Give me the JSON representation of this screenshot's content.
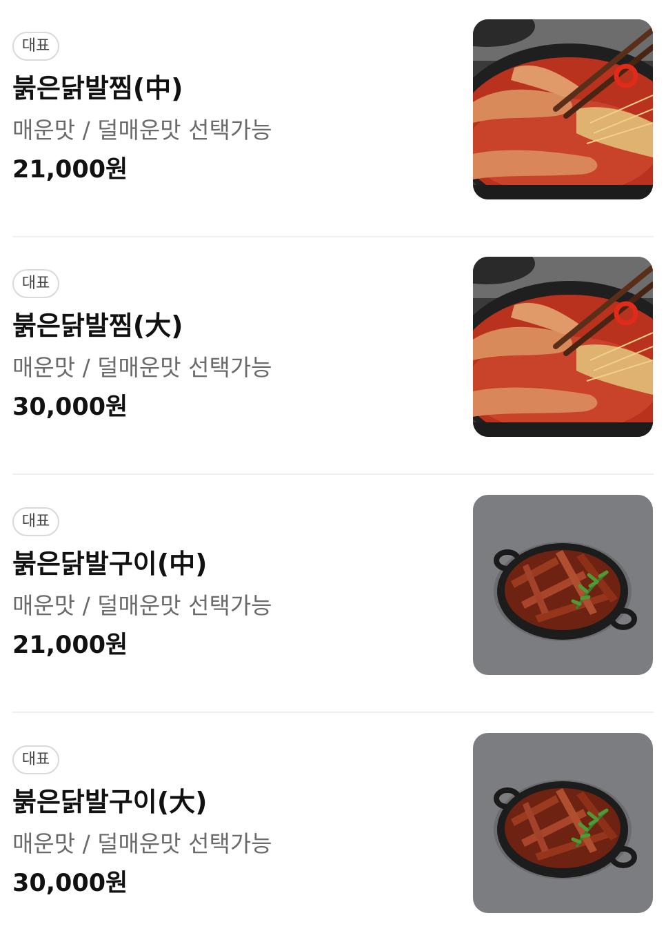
{
  "menu": {
    "items": [
      {
        "badge": "대표",
        "name": "붉은닭발찜(中)",
        "description": "매운맛 / 덜매운맛 선택가능",
        "price": "21,000원",
        "image": "spicy-chicken-feet-stew-photo"
      },
      {
        "badge": "대표",
        "name": "붉은닭발찜(大)",
        "description": "매운맛 / 덜매운맛 선택가능",
        "price": "30,000원",
        "image": "spicy-chicken-feet-stew-photo"
      },
      {
        "badge": "대표",
        "name": "붉은닭발구이(中)",
        "description": "매운맛 / 덜매운맛 선택가능",
        "price": "21,000원",
        "image": "grilled-chicken-feet-photo"
      },
      {
        "badge": "대표",
        "name": "붉은닭발구이(大)",
        "description": "매운맛 / 덜매운맛 선택가능",
        "price": "30,000원",
        "image": "grilled-chicken-feet-photo"
      }
    ]
  }
}
